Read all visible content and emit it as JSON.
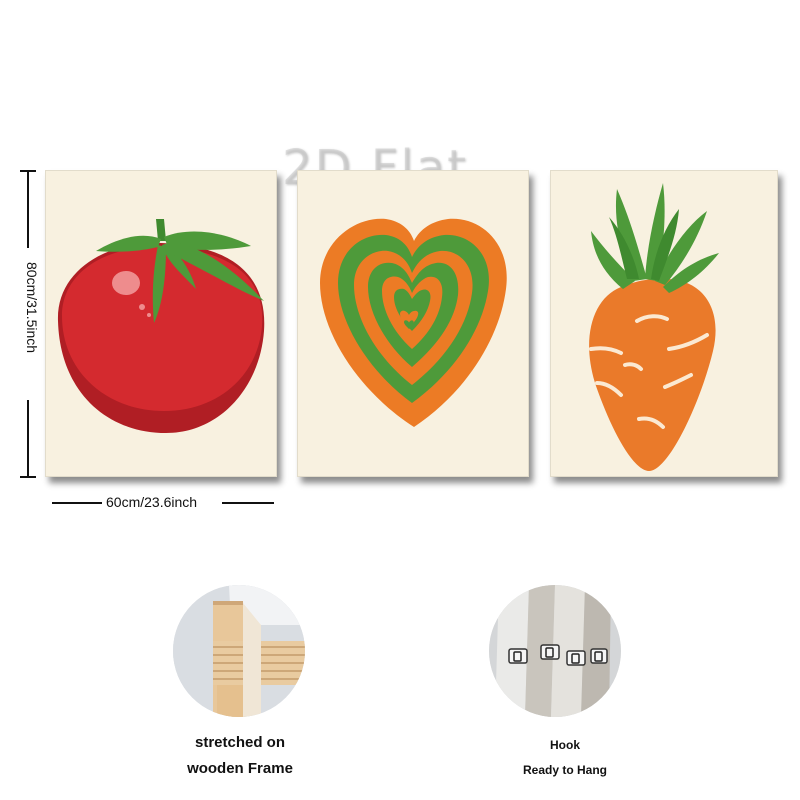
{
  "watermark": "2D Flat",
  "dimensions": {
    "height_label": "80cm/31.5inch",
    "width_label": "60cm/23.6inch"
  },
  "panels": [
    {
      "subject": "tomato"
    },
    {
      "subject": "striped heart"
    },
    {
      "subject": "carrot"
    }
  ],
  "features": [
    {
      "lines": [
        "stretched on",
        "wooden Frame"
      ]
    },
    {
      "lines": [
        "Hook",
        "Ready to Hang"
      ]
    }
  ],
  "colors": {
    "canvas": "#f8f1e0",
    "tomato": "#d42a2f",
    "leaf_green": "#4e9a3a",
    "orange": "#ec7b25"
  }
}
